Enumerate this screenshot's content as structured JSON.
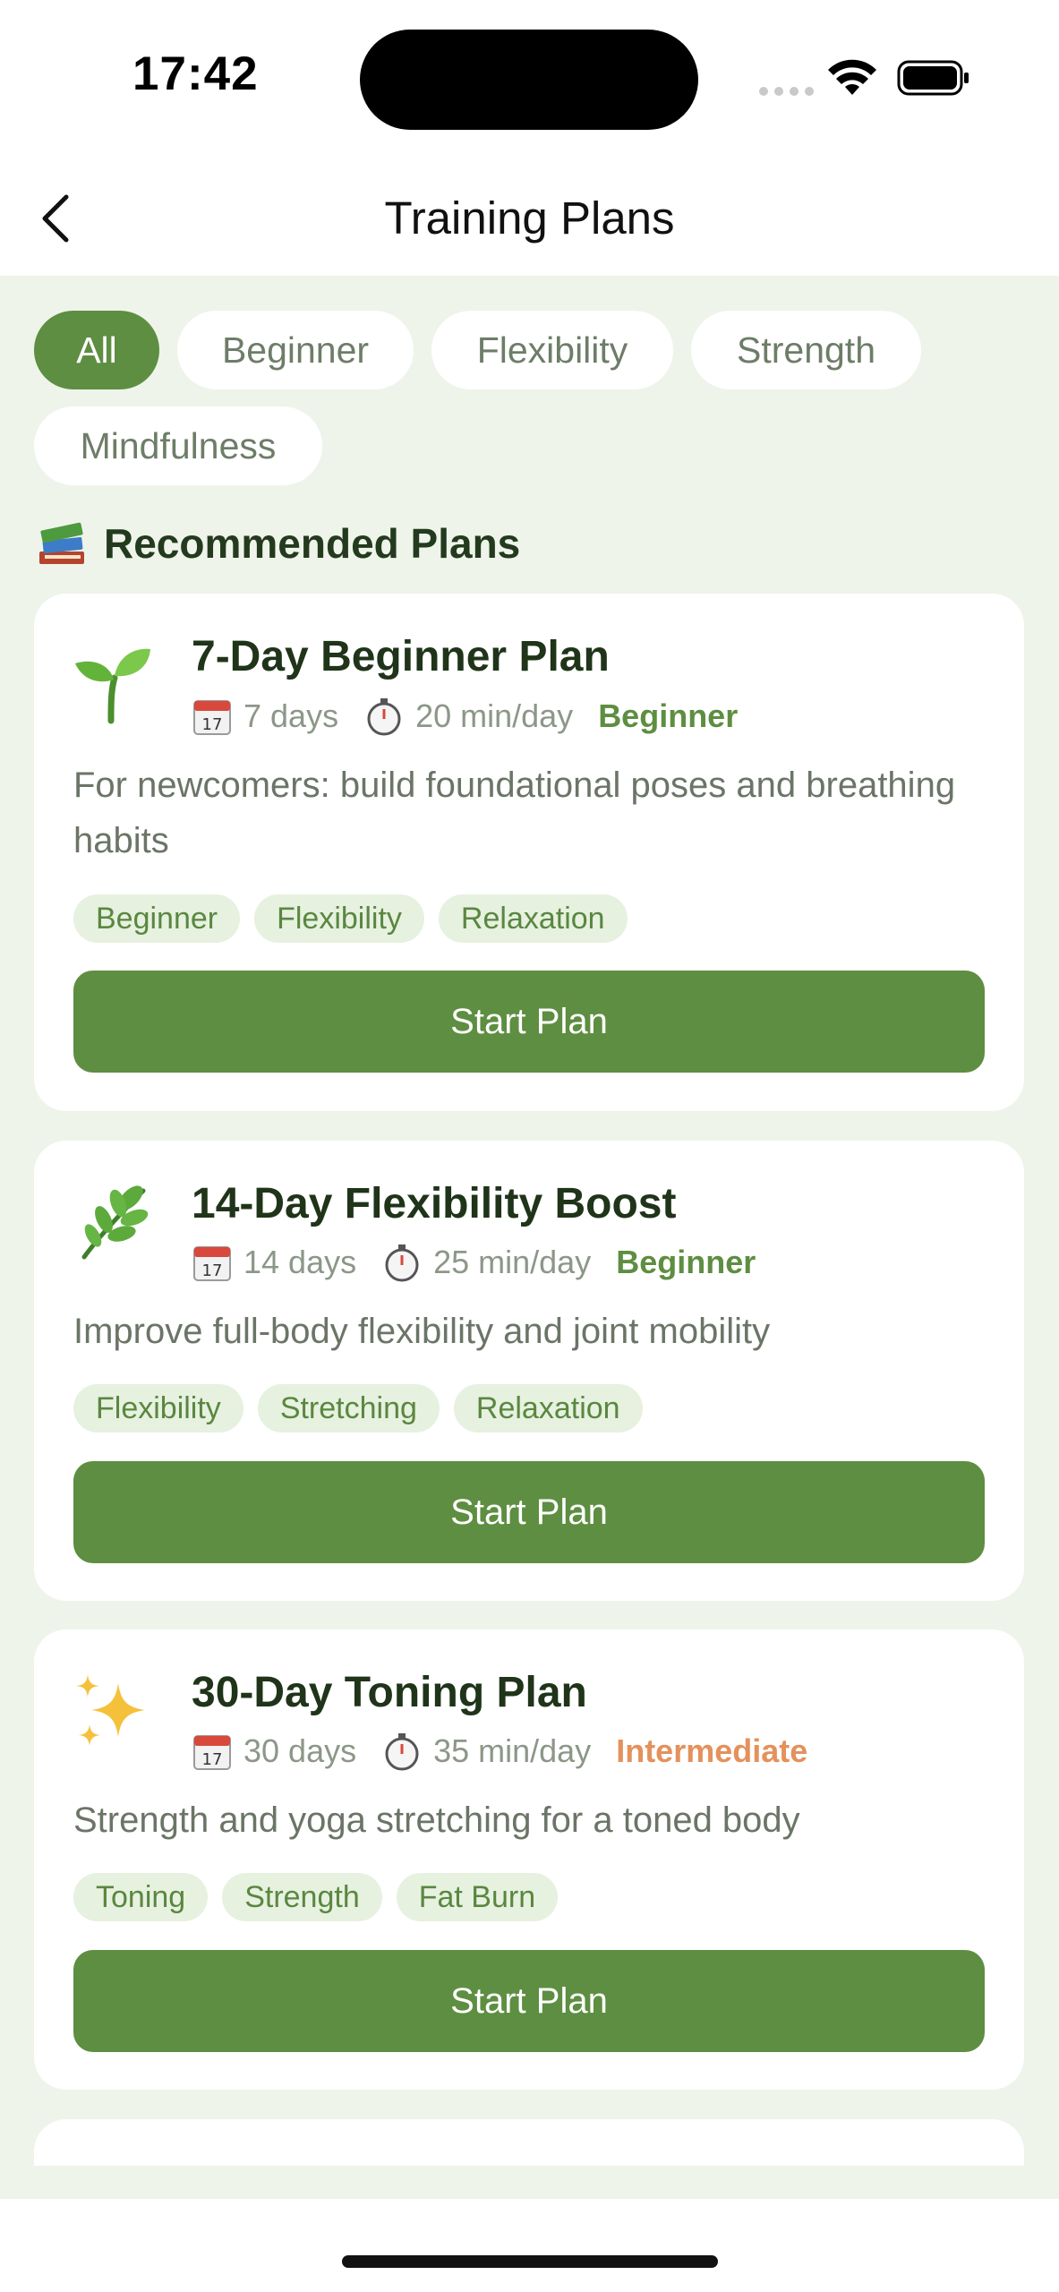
{
  "status": {
    "time": "17:42"
  },
  "nav": {
    "title": "Training Plans",
    "back_icon": "chevron-left-icon"
  },
  "filters": [
    {
      "label": "All",
      "active": true
    },
    {
      "label": "Beginner",
      "active": false
    },
    {
      "label": "Flexibility",
      "active": false
    },
    {
      "label": "Strength",
      "active": false
    },
    {
      "label": "Mindfulness",
      "active": false
    }
  ],
  "section": {
    "icon": "books-icon",
    "title": "Recommended Plans"
  },
  "plans": [
    {
      "icon": "seedling-icon",
      "title": "7-Day Beginner Plan",
      "days": "7 days",
      "duration": "20 min/day",
      "level": "Beginner",
      "description": "For newcomers: build foundational poses and breathing habits",
      "tags": [
        "Beginner",
        "Flexibility",
        "Relaxation"
      ],
      "button": "Start Plan"
    },
    {
      "icon": "herb-icon",
      "title": "14-Day Flexibility Boost",
      "days": "14 days",
      "duration": "25 min/day",
      "level": "Beginner",
      "description": "Improve full-body flexibility and joint mobility",
      "tags": [
        "Flexibility",
        "Stretching",
        "Relaxation"
      ],
      "button": "Start Plan"
    },
    {
      "icon": "sparkles-icon",
      "title": "30-Day Toning Plan",
      "days": "30 days",
      "duration": "35 min/day",
      "level": "Intermediate",
      "description": "Strength and yoga stretching for a toned body",
      "tags": [
        "Toning",
        "Strength",
        "Fat Burn"
      ],
      "button": "Start Plan"
    }
  ],
  "colors": {
    "accent": "#5E8E41",
    "background": "#EEF4EA",
    "tag_bg": "#E6F1DF",
    "intermediate": "#E4915C"
  }
}
